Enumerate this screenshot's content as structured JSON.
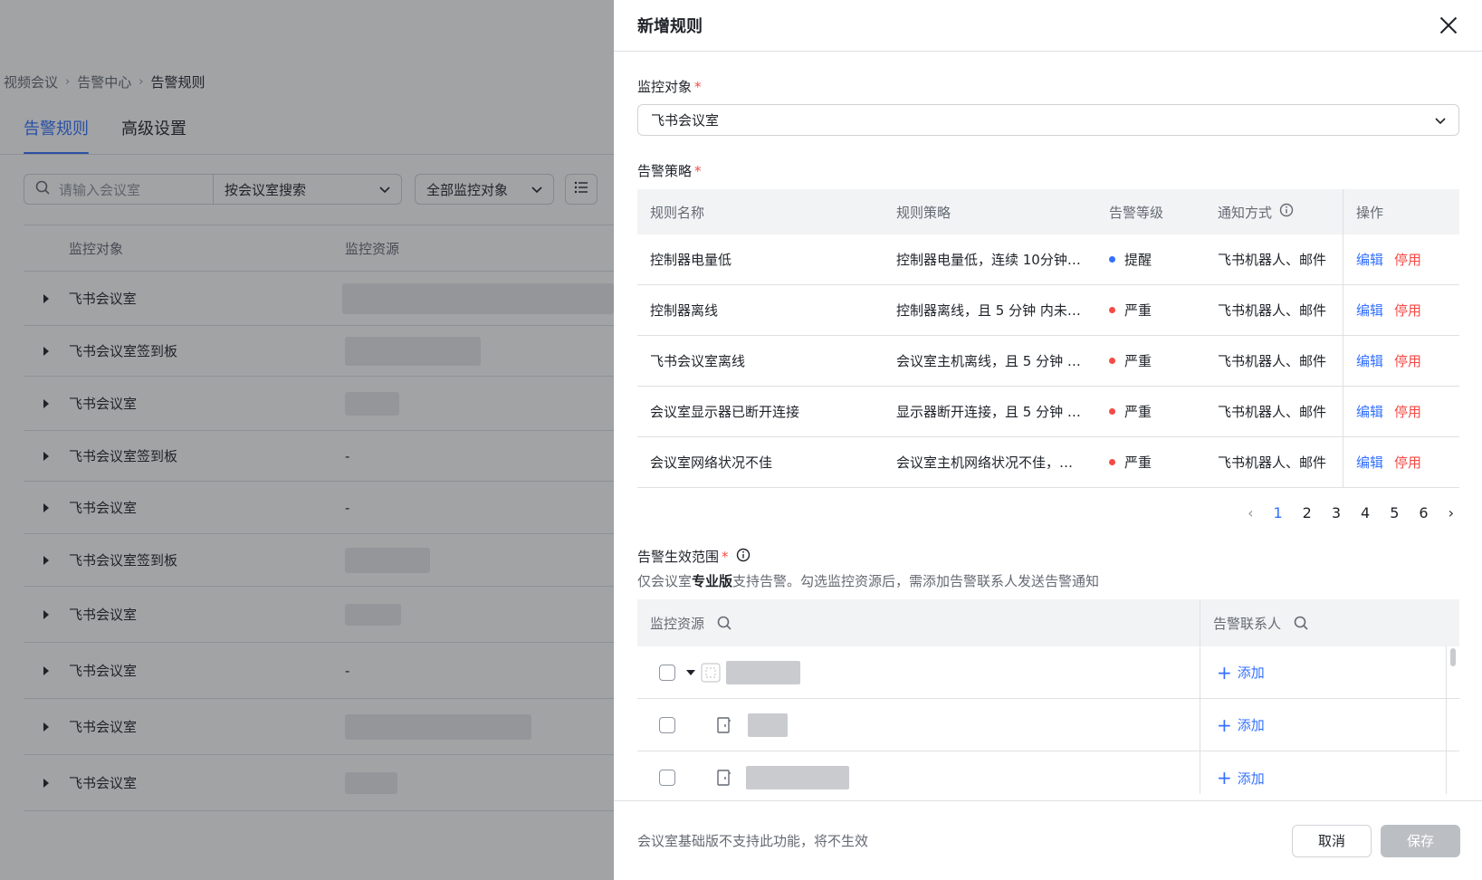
{
  "breadcrumb": [
    "视频会议",
    "告警中心",
    "告警规则"
  ],
  "tabs": [
    "告警规则",
    "高级设置"
  ],
  "filters": {
    "search_placeholder": "请输入会议室",
    "search_mode": "按会议室搜索",
    "monitor_filter": "全部监控对象"
  },
  "bg_table": {
    "headers": [
      "监控对象",
      "监控资源"
    ],
    "rows": [
      {
        "name": "飞书会议室",
        "resource": ""
      },
      {
        "name": "飞书会议室签到板",
        "resource": ""
      },
      {
        "name": "飞书会议室",
        "resource": ""
      },
      {
        "name": "飞书会议室签到板",
        "resource": "-"
      },
      {
        "name": "飞书会议室",
        "resource": "-"
      },
      {
        "name": "飞书会议室签到板",
        "resource": ""
      },
      {
        "name": "飞书会议室",
        "resource": ""
      },
      {
        "name": "飞书会议室",
        "resource": "-"
      },
      {
        "name": "飞书会议室",
        "resource": ""
      },
      {
        "name": "飞书会议室",
        "resource": ""
      }
    ]
  },
  "drawer": {
    "title": "新增规则",
    "monitor_object_label": "监控对象",
    "monitor_object_value": "飞书会议室",
    "policy_label": "告警策略",
    "rules_headers": [
      "规则名称",
      "规则策略",
      "告警等级",
      "通知方式",
      "操作"
    ],
    "rules": [
      {
        "name": "控制器电量低",
        "policy": "控制器电量低，连续 10分钟…",
        "level": "提醒",
        "level_color": "#3370ff",
        "notify": "飞书机器人、邮件",
        "edit": "编辑",
        "disable": "停用"
      },
      {
        "name": "控制器离线",
        "policy": "控制器离线，且 5 分钟 内未…",
        "level": "严重",
        "level_color": "#f54a45",
        "notify": "飞书机器人、邮件",
        "edit": "编辑",
        "disable": "停用"
      },
      {
        "name": "飞书会议室离线",
        "policy": "会议室主机离线，且 5 分钟 …",
        "level": "严重",
        "level_color": "#f54a45",
        "notify": "飞书机器人、邮件",
        "edit": "编辑",
        "disable": "停用"
      },
      {
        "name": "会议室显示器已断开连接",
        "policy": "显示器断开连接，且 5 分钟 …",
        "level": "严重",
        "level_color": "#f54a45",
        "notify": "飞书机器人、邮件",
        "edit": "编辑",
        "disable": "停用"
      },
      {
        "name": "会议室网络状况不佳",
        "policy": "会议室主机网络状况不佳，…",
        "level": "严重",
        "level_color": "#f54a45",
        "notify": "飞书机器人、邮件",
        "edit": "编辑",
        "disable": "停用"
      }
    ],
    "pagination": {
      "pages": [
        "1",
        "2",
        "3",
        "4",
        "5",
        "6"
      ],
      "current": "1"
    },
    "scope_label": "告警生效范围",
    "scope_desc_pre": "仅会议室",
    "scope_desc_bold": "专业版",
    "scope_desc_post": "支持告警。勾选监控资源后，需添加告警联系人发送告警通知",
    "scope_headers": [
      "监控资源",
      "告警联系人"
    ],
    "scope_rows": [
      {
        "add": "添加"
      },
      {
        "add": "添加"
      },
      {
        "add": "添加"
      }
    ],
    "footer_note": "会议室基础版不支持此功能，将不生效",
    "cancel": "取消",
    "save": "保存"
  }
}
